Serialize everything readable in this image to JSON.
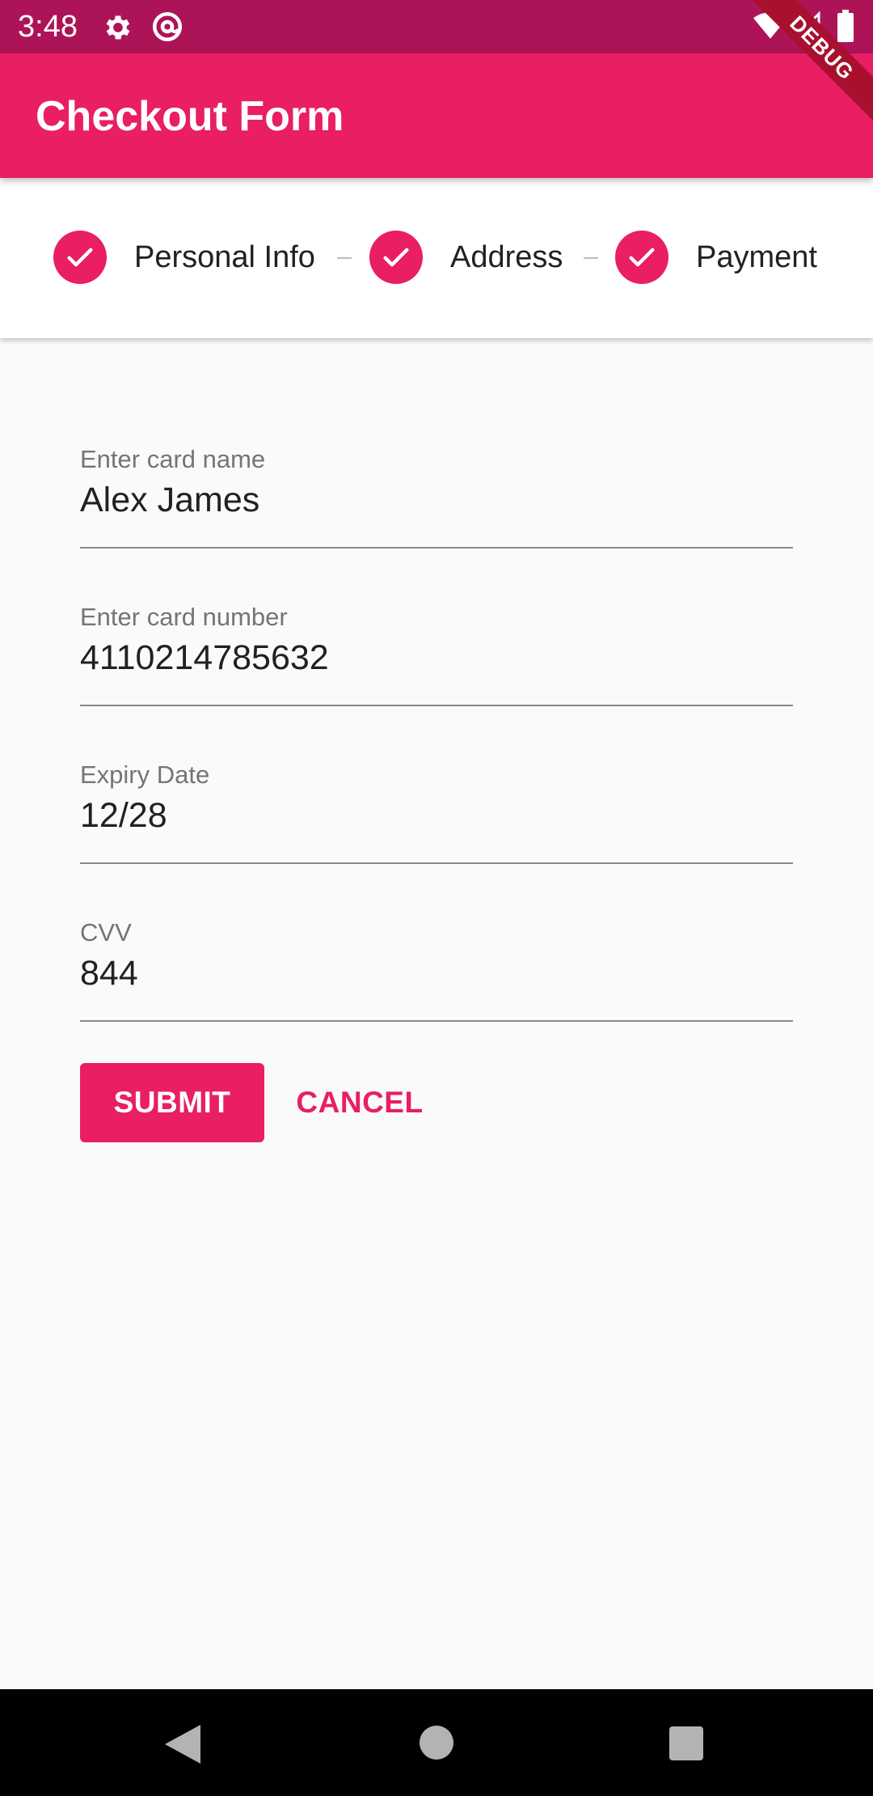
{
  "status_bar": {
    "time": "3:48",
    "icons": [
      "gear-icon",
      "at-sign-icon",
      "wifi-icon",
      "signal-icon",
      "battery-icon"
    ]
  },
  "debug_banner": "DEBUG",
  "app_bar": {
    "title": "Checkout Form"
  },
  "stepper": {
    "steps": [
      {
        "label": "Personal Info",
        "state": "completed"
      },
      {
        "label": "Address",
        "state": "completed"
      },
      {
        "label": "Payment",
        "state": "completed"
      }
    ]
  },
  "form": {
    "card_name": {
      "label": "Enter card name",
      "value": "Alex James"
    },
    "card_number": {
      "label": "Enter card number",
      "value": "4110214785632"
    },
    "expiry": {
      "label": "Expiry Date",
      "value": "12/28"
    },
    "cvv": {
      "label": "CVV",
      "value": "844"
    }
  },
  "actions": {
    "submit_label": "SUBMIT",
    "cancel_label": "CANCEL"
  },
  "colors": {
    "primary": "#e91e63",
    "primary_dark": "#ad1457",
    "background": "#fafafa",
    "text": "#212121",
    "label": "#757575"
  }
}
